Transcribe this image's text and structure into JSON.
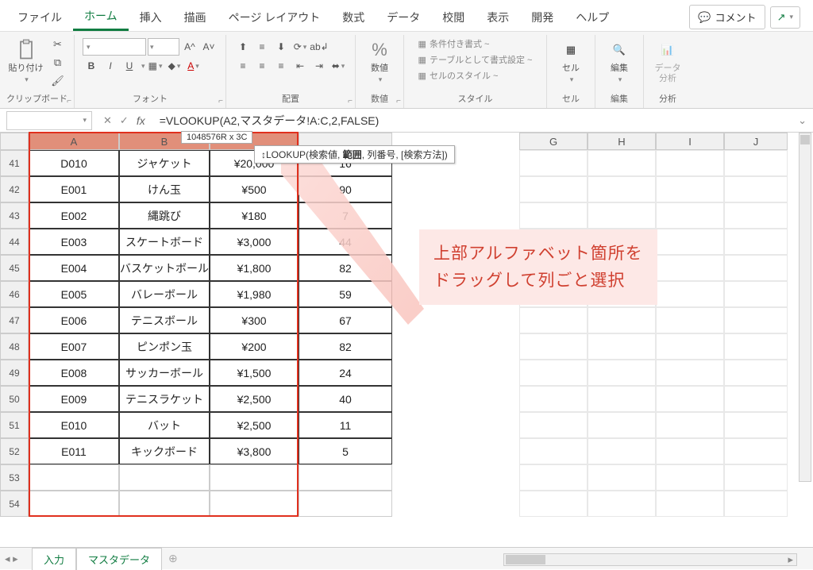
{
  "tabs": {
    "file": "ファイル",
    "home": "ホーム",
    "insert": "挿入",
    "draw": "描画",
    "layout": "ページ レイアウト",
    "formula": "数式",
    "data": "データ",
    "review": "校閲",
    "view": "表示",
    "dev": "開発",
    "help": "ヘルプ"
  },
  "comment_btn": "コメント",
  "groups": {
    "clipboard": "クリップボード",
    "font": "フォント",
    "align": "配置",
    "number": "数値",
    "styles": "スタイル",
    "cells": "セル",
    "edit": "編集",
    "analysis": "データ\n分析"
  },
  "clipboard": {
    "paste": "貼り付け"
  },
  "font": {
    "bold": "B",
    "italic": "I",
    "underline": "U"
  },
  "number": {
    "label": "数値"
  },
  "styles": {
    "cond": "条件付き書式 ~",
    "table": "テーブルとして書式設定 ~",
    "cell": "セルのスタイル ~"
  },
  "cells_btn": "セル",
  "edit_btn": "編集",
  "formula_text": "=VLOOKUP(A2,マスタデータ!A:C,2,FALSE)",
  "sel_tooltip": "1048576R x 3C",
  "func_hint": {
    "pre": "(  ",
    "name": "LOOKUP",
    "args": "(検索値, ",
    "bold": "範囲",
    "rest": ", 列番号, [検索方法])"
  },
  "col_widths": {
    "A": 114,
    "B": 114,
    "C": 112,
    "D": 118,
    "G": 86,
    "H": 86,
    "I": 86,
    "J": 80
  },
  "col_labels": [
    "A",
    "B",
    "",
    "",
    "G",
    "H",
    "I",
    "J"
  ],
  "row_start": 41,
  "rows": [
    {
      "a": "D010",
      "b": "ジャケット",
      "c": "¥20,000",
      "d": "16"
    },
    {
      "a": "E001",
      "b": "けん玉",
      "c": "¥500",
      "d": "90"
    },
    {
      "a": "E002",
      "b": "縄跳び",
      "c": "¥180",
      "d": "7"
    },
    {
      "a": "E003",
      "b": "スケートボード",
      "c": "¥3,000",
      "d": "44"
    },
    {
      "a": "E004",
      "b": "バスケットボール",
      "c": "¥1,800",
      "d": "82"
    },
    {
      "a": "E005",
      "b": "バレーボール",
      "c": "¥1,980",
      "d": "59"
    },
    {
      "a": "E006",
      "b": "テニスボール",
      "c": "¥300",
      "d": "67"
    },
    {
      "a": "E007",
      "b": "ピンポン玉",
      "c": "¥200",
      "d": "82"
    },
    {
      "a": "E008",
      "b": "サッカーボール",
      "c": "¥1,500",
      "d": "24"
    },
    {
      "a": "E009",
      "b": "テニスラケット",
      "c": "¥2,500",
      "d": "40"
    },
    {
      "a": "E010",
      "b": "バット",
      "c": "¥2,500",
      "d": "11"
    },
    {
      "a": "E011",
      "b": "キックボード",
      "c": "¥3,800",
      "d": "5"
    },
    {
      "a": "",
      "b": "",
      "c": "",
      "d": ""
    },
    {
      "a": "",
      "b": "",
      "c": "",
      "d": ""
    }
  ],
  "callout": {
    "l1": "上部アルファベット箇所を",
    "l2": "ドラッグして列ごと選択"
  },
  "sheets": {
    "s1": "入力",
    "s2": "マスタデータ"
  }
}
